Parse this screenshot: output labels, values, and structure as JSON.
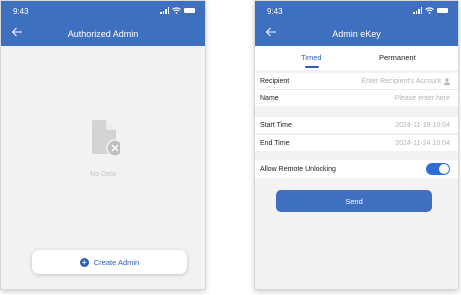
{
  "left": {
    "status": {
      "time": "9:43"
    },
    "title": "Authorized Admin",
    "empty_text": "No Data",
    "create_button_label": "Create Admin"
  },
  "right": {
    "status": {
      "time": "9:43"
    },
    "title": "Admin eKey",
    "tabs": [
      {
        "label": "Timed",
        "active": true
      },
      {
        "label": "Permanent",
        "active": false
      }
    ],
    "fields": {
      "recipient": {
        "label": "Recipient",
        "placeholder": "Enter Recipient's Account"
      },
      "name": {
        "label": "Name",
        "placeholder": "Please enter here"
      },
      "start_time": {
        "label": "Start Time",
        "value": "2024-11-19 10:04"
      },
      "end_time": {
        "label": "End Time",
        "value": "2024-11-24 10:04"
      },
      "remote_unlock": {
        "label": "Allow Remote Unlocking",
        "enabled": true
      }
    },
    "send_button_label": "Send"
  },
  "colors": {
    "header": "#3f6fbf",
    "accent": "#2c5fb0",
    "toggle_on": "#2e6fd6",
    "background": "#f2f2f2"
  },
  "icons": [
    "back-arrow-icon",
    "signal-icon",
    "wifi-icon",
    "battery-icon",
    "empty-document-icon",
    "plus-circle-icon",
    "person-icon"
  ]
}
